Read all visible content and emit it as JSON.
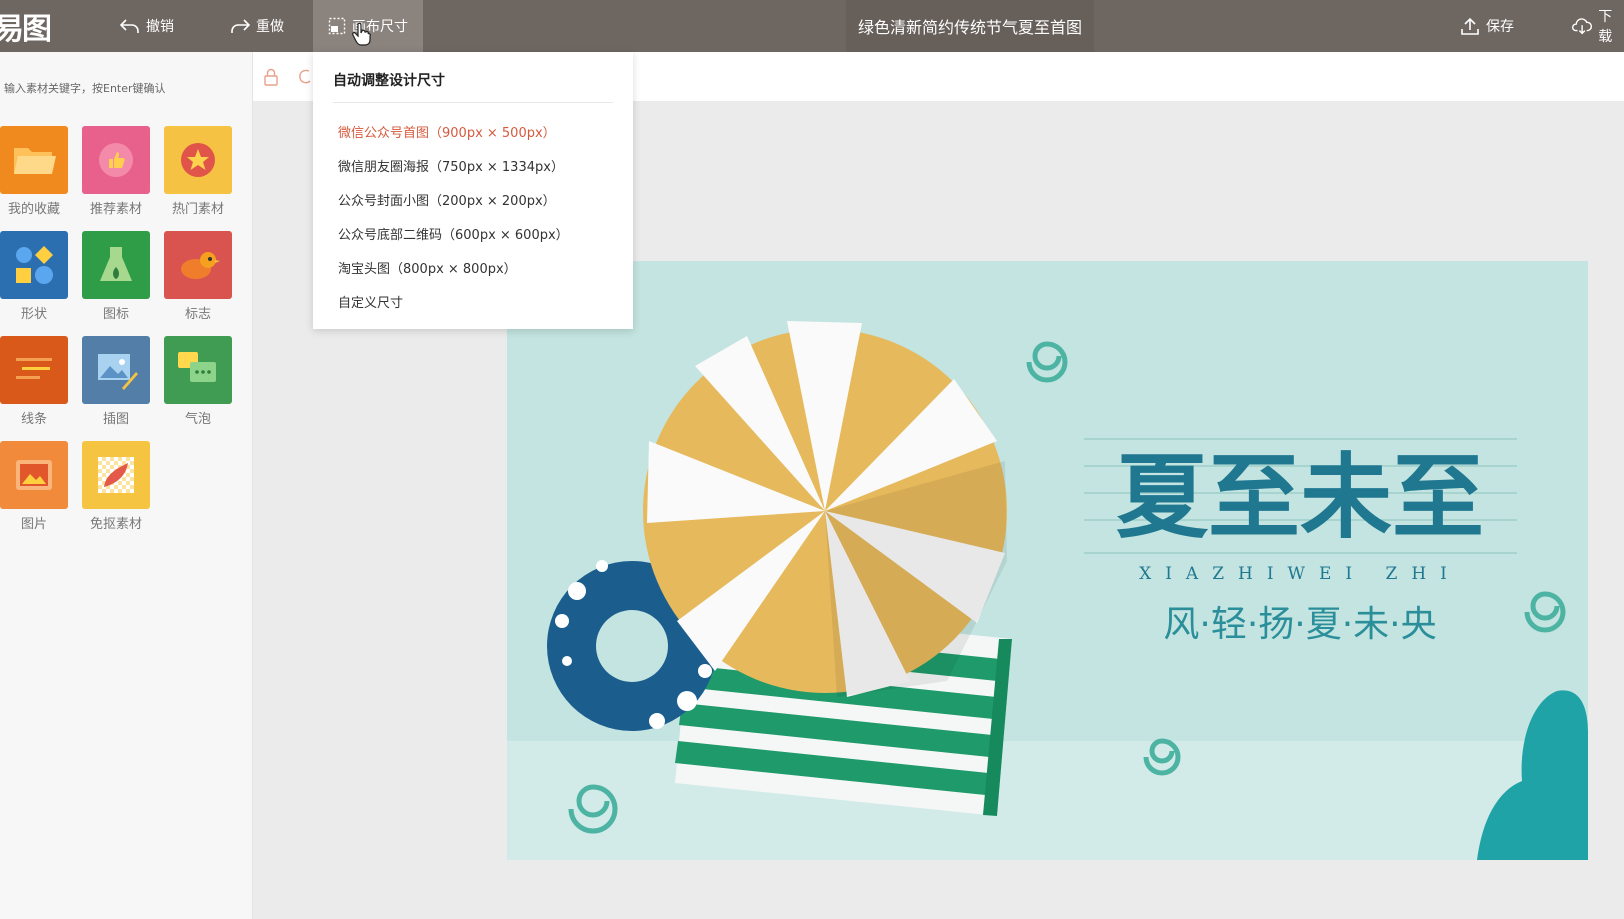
{
  "app": {
    "logo": "易图"
  },
  "toolbar": {
    "undo": "撤销",
    "redo": "重做",
    "canvas_size": "画布尺寸",
    "save": "保存",
    "download": "下载"
  },
  "document": {
    "title": "绿色清新简约传统节气夏至首图"
  },
  "sidebar": {
    "search_placeholder": "输入素材关键字，按Enter键确认",
    "categories": [
      {
        "label": "我的收藏",
        "icon": "folder-icon",
        "color": "#f08a1e"
      },
      {
        "label": "推荐素材",
        "icon": "thumbs-up-icon",
        "color": "#e8618c"
      },
      {
        "label": "热门素材",
        "icon": "star-icon",
        "color": "#f5c243"
      },
      {
        "label": "形状",
        "icon": "shapes-icon",
        "color": "#2c6fb0"
      },
      {
        "label": "图标",
        "icon": "flask-icon",
        "color": "#2f9c48"
      },
      {
        "label": "标志",
        "icon": "bird-icon",
        "color": "#d9534f"
      },
      {
        "label": "线条",
        "icon": "lines-icon",
        "color": "#d9591a"
      },
      {
        "label": "插图",
        "icon": "illustration-icon",
        "color": "#527ea8"
      },
      {
        "label": "气泡",
        "icon": "speech-bubble-icon",
        "color": "#3f9c52"
      },
      {
        "label": "图片",
        "icon": "image-icon",
        "color": "#f28a3c"
      },
      {
        "label": "免抠素材",
        "icon": "cutout-icon",
        "color": "#f5c542"
      }
    ]
  },
  "size_menu": {
    "title": "自动调整设计尺寸",
    "items": [
      {
        "label": "微信公众号首图（900px × 500px）",
        "selected": true
      },
      {
        "label": "微信朋友圈海报（750px × 1334px）",
        "selected": false
      },
      {
        "label": "公众号封面小图（200px × 200px）",
        "selected": false
      },
      {
        "label": "公众号底部二维码（600px × 600px）",
        "selected": false
      },
      {
        "label": "淘宝头图（800px × 800px）",
        "selected": false
      },
      {
        "label": "自定义尺寸",
        "selected": false
      }
    ]
  },
  "design": {
    "headline": "夏至未至",
    "pinyin": "XIAZHIWEI ZHI",
    "tagline": "风·轻·扬·夏·未·央",
    "colors": {
      "background": "#c3e4e0",
      "headline": "#1f7890",
      "umbrella": "#e6b95c",
      "ring": "#1b5e8e",
      "towel": "#1f9a6b"
    }
  }
}
